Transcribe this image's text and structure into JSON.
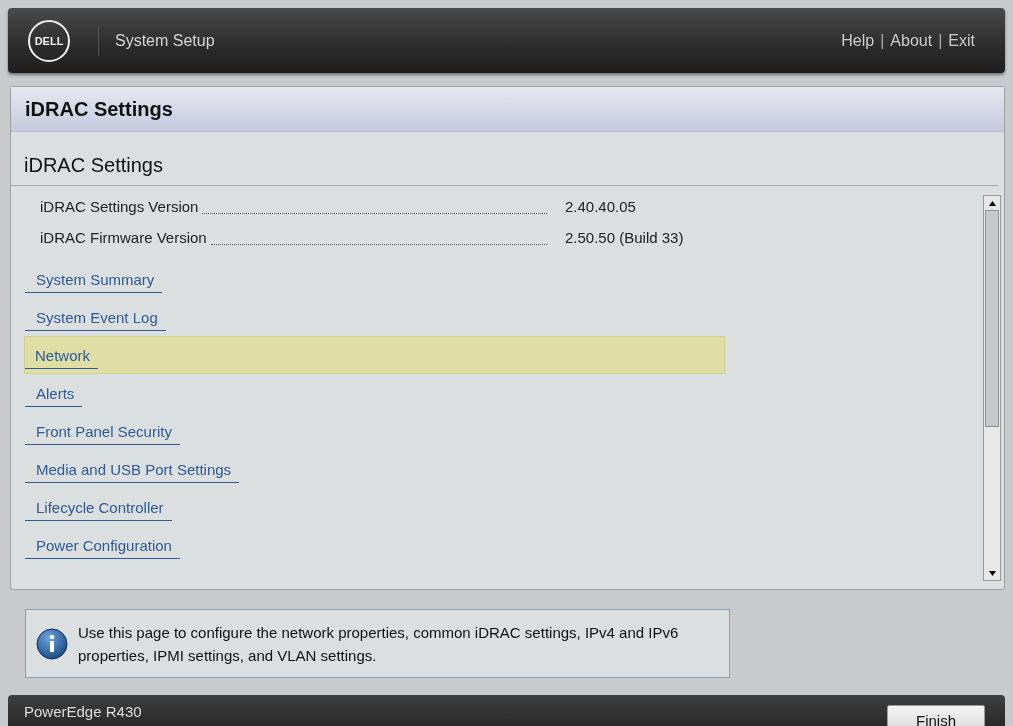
{
  "header": {
    "logo": "DELL",
    "title": "System Setup",
    "links": [
      {
        "label": "Help"
      },
      {
        "label": "About"
      },
      {
        "label": "Exit"
      }
    ],
    "separator": "|"
  },
  "panel": {
    "title": "iDRAC Settings",
    "subtitle": "iDRAC Settings",
    "fields": [
      {
        "label": "iDRAC Settings Version",
        "value": "2.40.40.05"
      },
      {
        "label": "iDRAC Firmware Version",
        "value": "2.50.50 (Build 33)"
      }
    ],
    "links": [
      {
        "label": "System Summary",
        "selected": false
      },
      {
        "label": "System Event Log",
        "selected": false
      },
      {
        "label": "Network",
        "selected": true
      },
      {
        "label": "Alerts",
        "selected": false
      },
      {
        "label": "Front Panel Security",
        "selected": false
      },
      {
        "label": "Media and USB Port Settings",
        "selected": false
      },
      {
        "label": "Lifecycle Controller",
        "selected": false
      },
      {
        "label": "Power Configuration",
        "selected": false
      }
    ]
  },
  "help": {
    "text": "Use this page to configure the network properties, common iDRAC settings, IPv4 and IPv6 properties, IPMI settings, and VLAN settings."
  },
  "footer": {
    "model": "PowerEdge R430",
    "button": "Finish"
  }
}
